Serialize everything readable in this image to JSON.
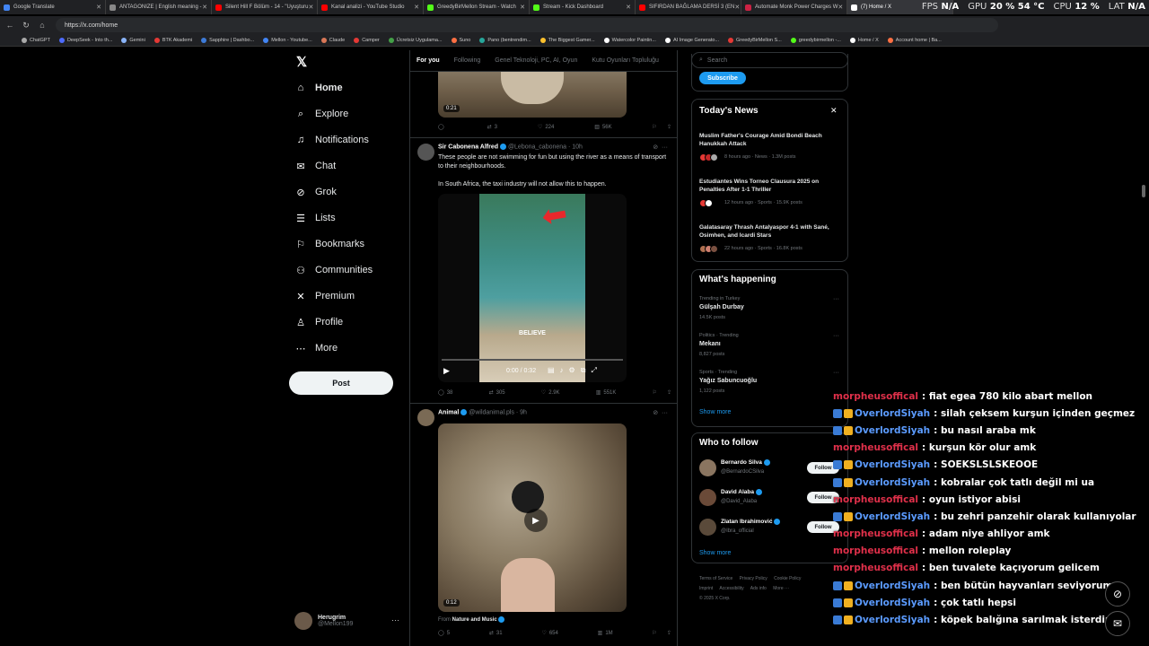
{
  "browser": {
    "tabs": [
      {
        "title": "Google Translate",
        "color": "#4285f4"
      },
      {
        "title": "ANTAGONIZE | English meaning -",
        "color": "#888888"
      },
      {
        "title": "Silent Hill F Bölüm - 14 - \"Uyuşturu",
        "color": "#ff0000"
      },
      {
        "title": "Kanal analizi - YouTube Studio",
        "color": "#ff0000"
      },
      {
        "title": "GreedyBirMellon Stream - Watch",
        "color": "#53fc18"
      },
      {
        "title": "Stream - Kick Dashboard",
        "color": "#53fc18"
      },
      {
        "title": "SIFIRDAN BAĞLAMA DERSİ 3 (EN",
        "color": "#ff0000"
      },
      {
        "title": "Automate Monk Power Charges W",
        "color": "#cc2244"
      },
      {
        "title": "(7) Home / X",
        "color": "#ffffff"
      }
    ],
    "url": "https://x.com/home",
    "bookmarks": [
      {
        "label": "ChatGPT",
        "color": "#aaaaaa"
      },
      {
        "label": "DeepSeek - Into th...",
        "color": "#4d6bfe"
      },
      {
        "label": "Gemini",
        "color": "#8ab4f8"
      },
      {
        "label": "BTK Akademi",
        "color": "#e53935"
      },
      {
        "label": "Sapphire | Dashbo...",
        "color": "#3d7bd9"
      },
      {
        "label": "Mellon - Youtube...",
        "color": "#4285f4"
      },
      {
        "label": "Claude",
        "color": "#d97757"
      },
      {
        "label": "Camper",
        "color": "#e53935"
      },
      {
        "label": "Ücretsiz Uygulama...",
        "color": "#43a047"
      },
      {
        "label": "Suno",
        "color": "#ff7043"
      },
      {
        "label": "Pano (bentrendim...",
        "color": "#26a69a"
      },
      {
        "label": "The Biggest Gamer...",
        "color": "#fbc02d"
      },
      {
        "label": "Watercolor Paintin...",
        "color": "#ffffff"
      },
      {
        "label": "AI Image Generato...",
        "color": "#ffffff"
      },
      {
        "label": "GreedyBirMellon S...",
        "color": "#e53935"
      },
      {
        "label": "greedybirmellon -...",
        "color": "#53fc18"
      },
      {
        "label": "Home / X",
        "color": "#ffffff"
      },
      {
        "label": "Account home | Ba...",
        "color": "#ff7043"
      }
    ]
  },
  "hud": {
    "fps_label": "FPS",
    "fps_value": "N/A",
    "gpu_label": "GPU",
    "gpu_value": "20 % 54 °C",
    "cpu_label": "CPU",
    "cpu_value": "12 %",
    "lat_label": "LAT",
    "lat_value": "N/A"
  },
  "nav": {
    "home": "Home",
    "explore": "Explore",
    "notifications": "Notifications",
    "chat": "Chat",
    "grok": "Grok",
    "lists": "Lists",
    "bookmarks": "Bookmarks",
    "communities": "Communities",
    "premium": "Premium",
    "profile": "Profile",
    "more": "More",
    "post": "Post"
  },
  "account": {
    "name": "Herugrim",
    "handle": "@Mellon199"
  },
  "feed": {
    "tabs": [
      "For you",
      "Following",
      "Genel Teknoloji, PC, AI, Oyun",
      "Kutu Oyunları Topluluğu"
    ],
    "tweets": [
      {
        "duration": "0:21",
        "replies": "",
        "reposts": "3",
        "likes": "224",
        "views": "56K"
      },
      {
        "name": "Sir Cabonena Alfred",
        "handle": "@Lebona_cabonena · 10h",
        "text1": "These people are not swimming for fun but using the river as a means of transport to their neighbourhoods.",
        "text2": "In South Africa, the taxi industry will not allow this to happen.",
        "caption": "BELIEVE",
        "time": "0:00 / 0:32",
        "replies": "38",
        "reposts": "305",
        "likes": "2.9K",
        "views": "551K"
      },
      {
        "name": "Animal",
        "handle": "@wildanimal.pls · 9h",
        "duration": "0:12",
        "from_label": "From",
        "from_source": "Nature and Music",
        "replies": "5",
        "reposts": "31",
        "likes": "654",
        "views": "1M"
      }
    ]
  },
  "right": {
    "search_placeholder": "Search",
    "subscribe": "Subscribe",
    "news_title": "Today's News",
    "news": [
      {
        "headline": "Muslim Father's Courage Amid Bondi Beach Hanukkah Attack",
        "meta": "8 hours ago · News · 1.3M posts"
      },
      {
        "headline": "Estudiantes Wins Torneo Clausura 2025 on Penalties After 1-1 Thriller",
        "meta": "12 hours ago · Sports · 15.9K posts"
      },
      {
        "headline": "Galatasaray Thrash Antalyaspor 4-1 with Sané, Osimhen, and Icardi Stars",
        "meta": "22 hours ago · Sports · 16.8K posts"
      }
    ],
    "happening_title": "What's happening",
    "trends": [
      {
        "context": "Trending in Turkey",
        "name": "Gülşah Durbay",
        "posts": "14.5K posts"
      },
      {
        "context": "Politics · Trending",
        "name": "Mekanı",
        "posts": "8,827 posts"
      },
      {
        "context": "Sports · Trending",
        "name": "Yağız Sabuncuoğlu",
        "posts": "1,122 posts"
      }
    ],
    "show_more": "Show more",
    "wtf_title": "Who to follow",
    "follow": [
      {
        "name": "Bernardo Silva",
        "handle": "@BernardoCSilva"
      },
      {
        "name": "David Alaba",
        "handle": "@David_Alaba"
      },
      {
        "name": "Zlatan Ibrahimović",
        "handle": "@Ibra_official"
      }
    ],
    "follow_label": "Follow",
    "footer": [
      "Terms of Service",
      "Privacy Policy",
      "Cookie Policy",
      "Imprint",
      "Accessibility",
      "Ads info",
      "More ···",
      "© 2025 X Corp."
    ]
  },
  "chat": [
    {
      "user": "morpheusoffical",
      "color": "#e0304a",
      "badges": false,
      "msg": ": fiat egea 780 kilo abart mellon"
    },
    {
      "user": "OverlordSiyah",
      "color": "#5b9bff",
      "badges": true,
      "msg": ": silah çeksem kurşun içinden geçmez"
    },
    {
      "user": "OverlordSiyah",
      "color": "#5b9bff",
      "badges": true,
      "msg": ": bu nasıl araba mk"
    },
    {
      "user": "morpheusoffical",
      "color": "#e0304a",
      "badges": false,
      "msg": ": kurşun kör olur amk"
    },
    {
      "user": "OverlordSiyah",
      "color": "#5b9bff",
      "badges": true,
      "msg": ": SOEKSLSLSKEOOE"
    },
    {
      "user": "OverlordSiyah",
      "color": "#5b9bff",
      "badges": true,
      "msg": ": kobralar çok tatlı değil mi ua"
    },
    {
      "user": "morpheusoffical",
      "color": "#e0304a",
      "badges": false,
      "msg": ": oyun istiyor abisi"
    },
    {
      "user": "OverlordSiyah",
      "color": "#5b9bff",
      "badges": true,
      "msg": ": bu zehri panzehir olarak kullanıyolar"
    },
    {
      "user": "morpheusoffical",
      "color": "#e0304a",
      "badges": false,
      "msg": ": adam niye ahliyor amk"
    },
    {
      "user": "morpheusoffical",
      "color": "#e0304a",
      "badges": false,
      "msg": ": mellon roleplay"
    },
    {
      "user": "morpheusoffical",
      "color": "#e0304a",
      "badges": false,
      "msg": ": ben tuvalete kaçıyorum gelicem"
    },
    {
      "user": "OverlordSiyah",
      "color": "#5b9bff",
      "badges": true,
      "msg": ": ben bütün hayvanları seviyorum"
    },
    {
      "user": "OverlordSiyah",
      "color": "#5b9bff",
      "badges": true,
      "msg": ": çok tatlı hepsi"
    },
    {
      "user": "OverlordSiyah",
      "color": "#5b9bff",
      "badges": true,
      "msg": ": köpek balığına sarılmak isterdim"
    }
  ]
}
